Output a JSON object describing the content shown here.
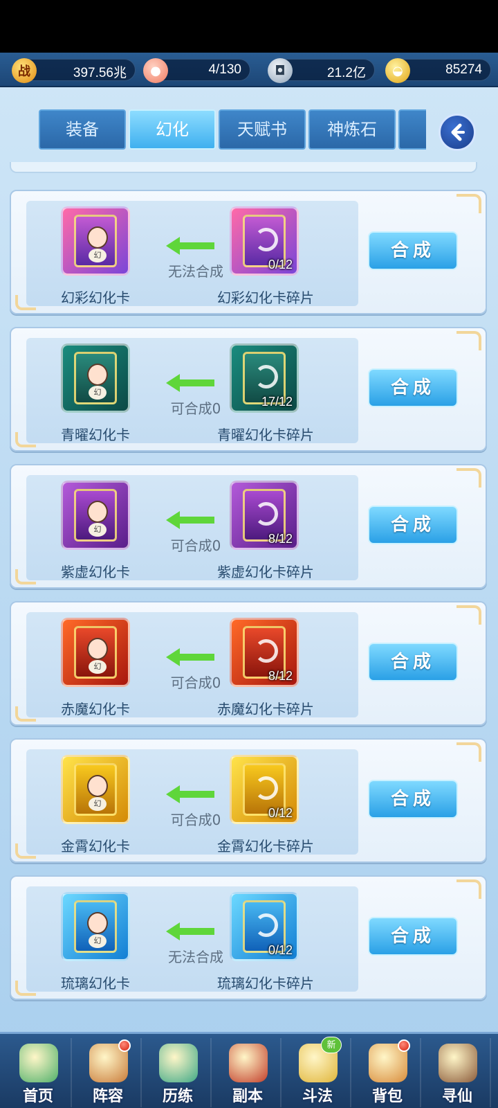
{
  "resources": {
    "battle_power": {
      "icon": "battle-power-icon",
      "glyph": "战",
      "value": "397.56兆"
    },
    "stamina": {
      "icon": "peach-icon",
      "value": "4/130"
    },
    "silver": {
      "icon": "silver-coin-icon",
      "value": "21.2亿"
    },
    "gold": {
      "icon": "gold-ingot-icon",
      "value": "85274"
    }
  },
  "tabs": [
    {
      "label": "装备",
      "active": false
    },
    {
      "label": "幻化",
      "active": true
    },
    {
      "label": "天赋书",
      "active": false
    },
    {
      "label": "神炼石",
      "active": false
    }
  ],
  "back_icon": "chevron-left-icon",
  "synth_label": "合成",
  "card_glyph": "幻",
  "items": [
    {
      "target": "幻彩幻化卡",
      "fragment": "幻彩幻化卡碎片",
      "count": "0/12",
      "status": "无法合成",
      "theme": "rainbow"
    },
    {
      "target": "青曜幻化卡",
      "fragment": "青曜幻化卡碎片",
      "count": "17/12",
      "status": "可合成0",
      "theme": "teal"
    },
    {
      "target": "紫虚幻化卡",
      "fragment": "紫虚幻化卡碎片",
      "count": "8/12",
      "status": "可合成0",
      "theme": "purple"
    },
    {
      "target": "赤魔幻化卡",
      "fragment": "赤魔幻化卡碎片",
      "count": "8/12",
      "status": "可合成0",
      "theme": "red"
    },
    {
      "target": "金霄幻化卡",
      "fragment": "金霄幻化卡碎片",
      "count": "0/12",
      "status": "可合成0",
      "theme": "gold"
    },
    {
      "target": "琉璃幻化卡",
      "fragment": "琉璃幻化卡碎片",
      "count": "0/12",
      "status": "无法合成",
      "theme": "blue"
    }
  ],
  "nav": [
    {
      "label": "首页",
      "icon": "home-icon",
      "badge": ""
    },
    {
      "label": "阵容",
      "icon": "lineup-icon",
      "badge": "dot"
    },
    {
      "label": "历练",
      "icon": "training-icon",
      "badge": ""
    },
    {
      "label": "副本",
      "icon": "dungeon-icon",
      "badge": ""
    },
    {
      "label": "斗法",
      "icon": "battle-icon",
      "badge": "新"
    },
    {
      "label": "背包",
      "icon": "bag-icon",
      "badge": "dot"
    },
    {
      "label": "寻仙",
      "icon": "seek-immortal-icon",
      "badge": ""
    }
  ],
  "colors": {
    "accent": "#2aa0e6",
    "arrow": "#5fd63a",
    "nav_bg": "#1a3a63"
  }
}
